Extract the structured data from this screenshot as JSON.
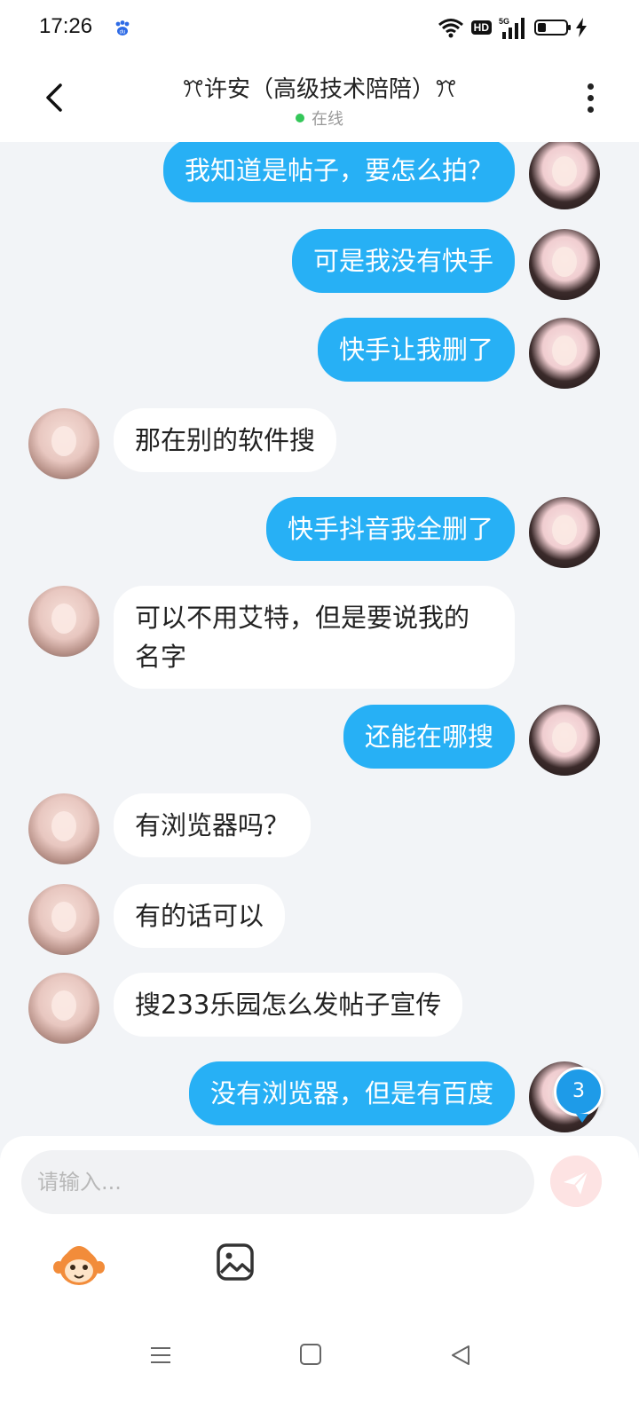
{
  "status": {
    "time": "17:26",
    "network": "5G",
    "hd": "HD",
    "battery_level": 0.3
  },
  "header": {
    "title": "ꔫ许安（高级技术陪陪）ꔫ",
    "status": "在线"
  },
  "messages": [
    {
      "side": "me",
      "text": "我知道是帖子，要怎么拍？"
    },
    {
      "side": "me",
      "text": "可是我没有快手"
    },
    {
      "side": "me",
      "text": "快手让我删了"
    },
    {
      "side": "them",
      "text": "那在别的软件搜"
    },
    {
      "side": "me",
      "text": "快手抖音我全删了"
    },
    {
      "side": "them",
      "text": "可以不用艾特，但是要说我的名字"
    },
    {
      "side": "me",
      "text": "还能在哪搜"
    },
    {
      "side": "them",
      "text": "有浏览器吗？"
    },
    {
      "side": "them",
      "text": "有的话可以"
    },
    {
      "side": "them",
      "text": "搜233乐园怎么发帖子宣传"
    },
    {
      "side": "me",
      "text": "没有浏览器，但是有百度"
    }
  ],
  "unread_badge": "3",
  "composer": {
    "placeholder": "请输入...",
    "send_icon": "send-icon",
    "tools": [
      "monkey-sticker-icon",
      "image-icon"
    ]
  },
  "navbar": [
    "menu-icon",
    "home-icon",
    "back-icon"
  ],
  "colors": {
    "accent": "#27b0f5",
    "background": "#f2f4f7",
    "online": "#34c759"
  }
}
